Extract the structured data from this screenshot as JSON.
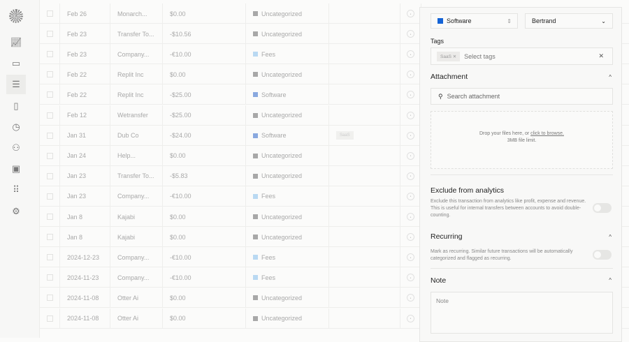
{
  "sidebar": {
    "items": [
      "analytics",
      "inbox",
      "transactions",
      "invoices",
      "tracker",
      "customers",
      "vault",
      "apps",
      "settings"
    ],
    "active": "transactions"
  },
  "rows": [
    {
      "date": "Feb 26",
      "description": "Monarch...",
      "amount": "$0.00",
      "category": "Uncategorized",
      "color": "#a8a8a8",
      "tag": ""
    },
    {
      "date": "Feb 23",
      "description": "Transfer To...",
      "amount": "-$10.56",
      "category": "Uncategorized",
      "color": "#a8a8a8",
      "tag": ""
    },
    {
      "date": "Feb 23",
      "description": "Company...",
      "amount": "-€10.00",
      "category": "Fees",
      "color": "#b9d9f2",
      "tag": ""
    },
    {
      "date": "Feb 22",
      "description": "Replit Inc",
      "amount": "$0.00",
      "category": "Uncategorized",
      "color": "#a8a8a8",
      "tag": ""
    },
    {
      "date": "Feb 22",
      "description": "Replit Inc",
      "amount": "-$25.00",
      "category": "Software",
      "color": "#8aa9df",
      "tag": ""
    },
    {
      "date": "Feb 12",
      "description": "Wetransfer",
      "amount": "-$25.00",
      "category": "Uncategorized",
      "color": "#a8a8a8",
      "tag": ""
    },
    {
      "date": "Jan 31",
      "description": "Dub Co",
      "amount": "-$24.00",
      "category": "Software",
      "color": "#8aa9df",
      "tag": "SaaS"
    },
    {
      "date": "Jan 24",
      "description": "Help...",
      "amount": "$0.00",
      "category": "Uncategorized",
      "color": "#a8a8a8",
      "tag": ""
    },
    {
      "date": "Jan 23",
      "description": "Transfer To...",
      "amount": "-$5.83",
      "category": "Uncategorized",
      "color": "#a8a8a8",
      "tag": ""
    },
    {
      "date": "Jan 23",
      "description": "Company...",
      "amount": "-€10.00",
      "category": "Fees",
      "color": "#b9d9f2",
      "tag": ""
    },
    {
      "date": "Jan 8",
      "description": "Kajabi",
      "amount": "$0.00",
      "category": "Uncategorized",
      "color": "#a8a8a8",
      "tag": ""
    },
    {
      "date": "Jan 8",
      "description": "Kajabi",
      "amount": "$0.00",
      "category": "Uncategorized",
      "color": "#a8a8a8",
      "tag": ""
    },
    {
      "date": "2024-12-23",
      "description": "Company...",
      "amount": "-€10.00",
      "category": "Fees",
      "color": "#b9d9f2",
      "tag": ""
    },
    {
      "date": "2024-11-23",
      "description": "Company...",
      "amount": "-€10.00",
      "category": "Fees",
      "color": "#b9d9f2",
      "tag": ""
    },
    {
      "date": "2024-11-08",
      "description": "Otter Ai",
      "amount": "$0.00",
      "category": "Uncategorized",
      "color": "#a8a8a8",
      "tag": ""
    },
    {
      "date": "2024-11-08",
      "description": "Otter Ai",
      "amount": "$0.00",
      "category": "Uncategorized",
      "color": "#a8a8a8",
      "tag": ""
    }
  ],
  "panel": {
    "category": "Software",
    "category_color": "#1463d6",
    "assignee": "Bertrand",
    "tags_label": "Tags",
    "tag": "SaaS",
    "tags_placeholder": "Select tags",
    "attachment_title": "Attachment",
    "attachment_placeholder": "Search attachment",
    "drop_text": "Drop your files here, or ",
    "drop_link": "click to browse.",
    "drop_limit": "3MB file limit.",
    "exclude_title": "Exclude from analytics",
    "exclude_desc": "Exclude this transaction from analytics like profit, expense and revenue. This is useful for internal transfers between accounts to avoid double-counting.",
    "exclude_on": false,
    "recurring_title": "Recurring",
    "recurring_desc": "Mark as recurring. Similar future transactions will be automatically categorized and flagged as recurring.",
    "recurring_on": false,
    "note_title": "Note",
    "note_placeholder": "Note"
  }
}
